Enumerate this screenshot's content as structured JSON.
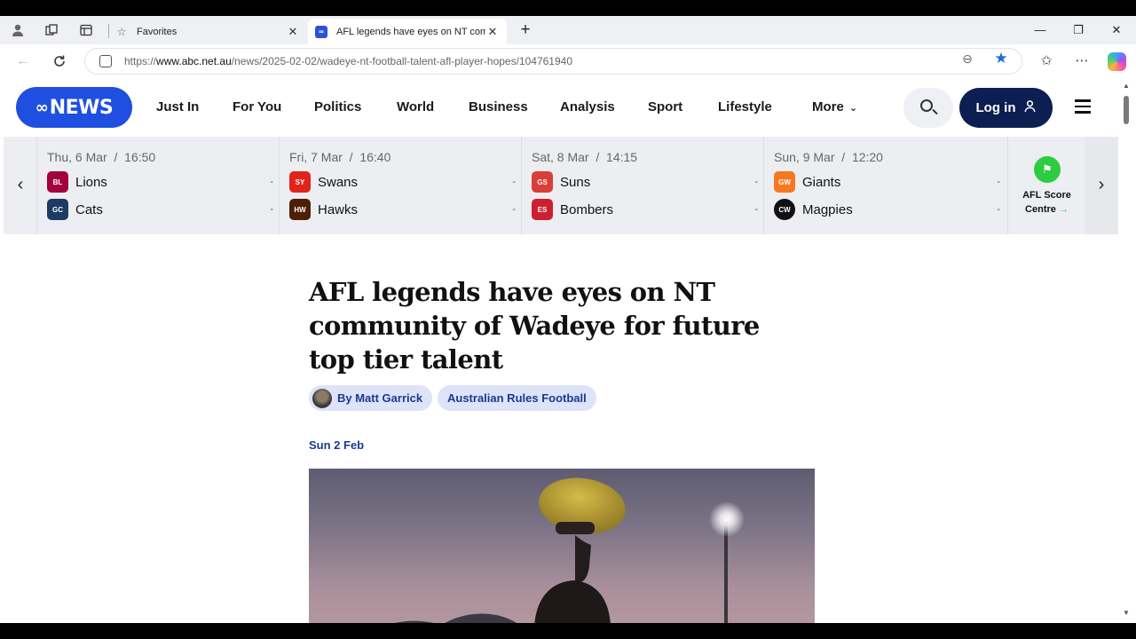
{
  "browser": {
    "tabs": [
      {
        "title": "Favorites",
        "active": false
      },
      {
        "title": "AFL legends have eyes on NT community of Wadeye for future top tier talent",
        "active": true
      }
    ],
    "url_prefix": "https://",
    "url_domain": "www.abc.net.au",
    "url_path": "/news/2025-02-02/wadeye-nt-football-talent-afl-player-hopes/104761940",
    "window_controls": [
      "minimize",
      "restore",
      "close"
    ]
  },
  "site": {
    "logo_text": "NEWS",
    "nav": [
      "Just In",
      "For You",
      "Politics",
      "World",
      "Business",
      "Analysis",
      "Sport",
      "Lifestyle"
    ],
    "more_label": "More",
    "login_label": "Log in"
  },
  "scores": {
    "fixtures": [
      {
        "date": "Thu, 6 Mar",
        "time": "16:50",
        "home": "Lions",
        "away": "Cats",
        "home_score": "-",
        "away_score": "-",
        "home_color": "#a3003e",
        "away_color": "#1c3c63"
      },
      {
        "date": "Fri, 7 Mar",
        "time": "16:40",
        "home": "Swans",
        "away": "Hawks",
        "home_score": "-",
        "away_score": "-",
        "home_color": "#e2231a",
        "away_color": "#4d2004"
      },
      {
        "date": "Sat, 8 Mar",
        "time": "14:15",
        "home": "Suns",
        "away": "Bombers",
        "home_score": "-",
        "away_score": "-",
        "home_color": "#d93e39",
        "away_color": "#cc2031"
      },
      {
        "date": "Sun, 9 Mar",
        "time": "12:20",
        "home": "Giants",
        "away": "Magpies",
        "home_score": "-",
        "away_score": "-",
        "home_color": "#f47920",
        "away_color": "#111111"
      }
    ],
    "score_centre_label_1": "AFL Score",
    "score_centre_label_2": "Centre"
  },
  "article": {
    "headline": "AFL legends have eyes on NT community of Wadeye for future top tier talent",
    "author": "By Matt Garrick",
    "topic": "Australian Rules Football",
    "date": "Sun 2 Feb"
  },
  "colors": {
    "brand": "#1f4fe0",
    "login_bg": "#0c1e52",
    "chip_bg": "#dde3f8",
    "chip_text": "#1a3a8f",
    "score_centre_green": "#2ecc40"
  }
}
